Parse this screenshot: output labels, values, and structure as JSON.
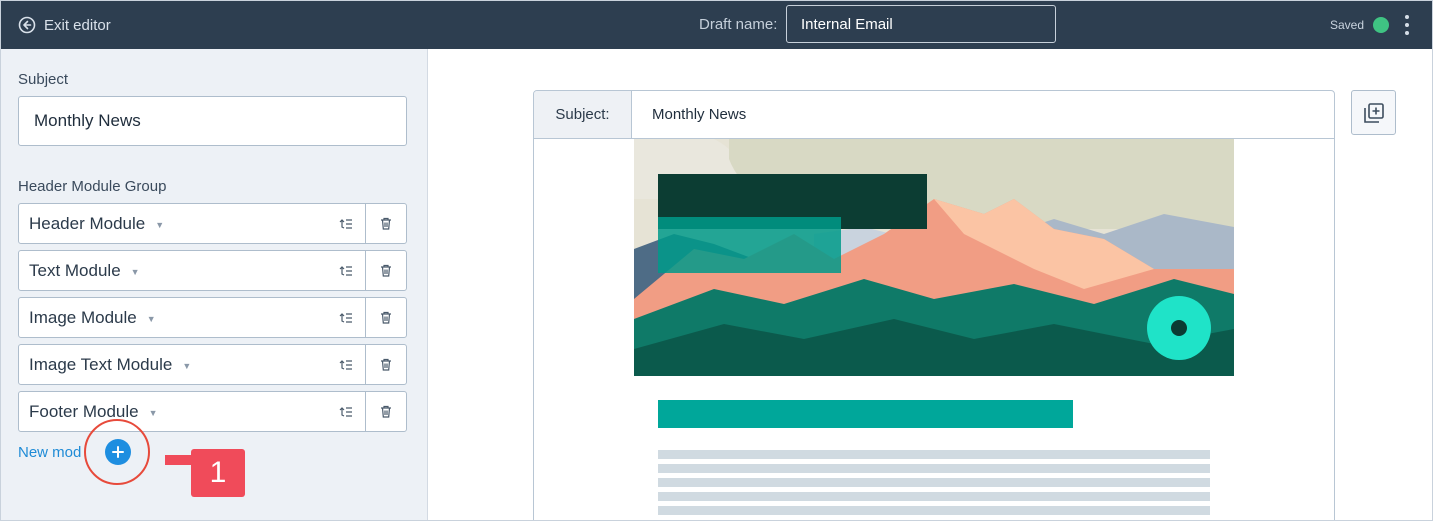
{
  "topbar": {
    "exit_label": "Exit editor",
    "draft_label": "Draft name:",
    "draft_value": "Internal Email",
    "saved_label": "Saved",
    "saved_color": "#3fc383"
  },
  "sidebar": {
    "subject_label": "Subject",
    "subject_value": "Monthly News",
    "group_label": "Header Module Group",
    "modules": [
      {
        "label": "Header Module"
      },
      {
        "label": "Text Module"
      },
      {
        "label": "Image Module"
      },
      {
        "label": "Image Text Module"
      },
      {
        "label": "Footer Module"
      }
    ],
    "new_module_label": "New mod"
  },
  "callout": {
    "number": "1",
    "color": "#f04b5a"
  },
  "preview": {
    "subject_key": "Subject:",
    "subject_value": "Monthly News",
    "accent": "#00a79a"
  },
  "icons": [
    "exit-arrow-icon",
    "kebab-menu-icon",
    "chevron-down-icon",
    "reorder-icon",
    "trash-icon",
    "plus-icon",
    "add-to-collection-icon"
  ]
}
